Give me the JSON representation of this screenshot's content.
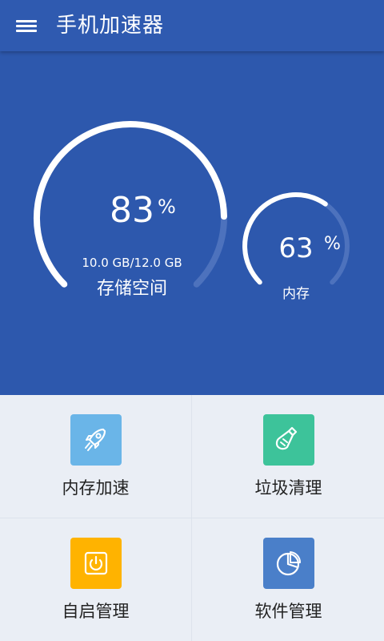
{
  "app_bar": {
    "title": "手机加速器"
  },
  "storage": {
    "percent": 83,
    "percent_text": "83",
    "percent_sign": "%",
    "usage": "10.0 GB/12.0 GB",
    "label": "存储空间"
  },
  "memory": {
    "percent": 63,
    "percent_text": "63",
    "percent_sign": "%",
    "label": "内存"
  },
  "tiles": [
    {
      "label": "内存加速",
      "icon": "rocket-icon",
      "color": "#6ab5e8"
    },
    {
      "label": "垃圾清理",
      "icon": "broom-icon",
      "color": "#3dc39a"
    },
    {
      "label": "自启管理",
      "icon": "power-icon",
      "color": "#ffb300"
    },
    {
      "label": "软件管理",
      "icon": "pie-chart-icon",
      "color": "#4a7fc9"
    }
  ],
  "colors": {
    "app_bar": "#2f5ab0",
    "hero_bg": "#2d58ad",
    "arc_fill": "#ffffff",
    "arc_track": "#4d72bd"
  }
}
